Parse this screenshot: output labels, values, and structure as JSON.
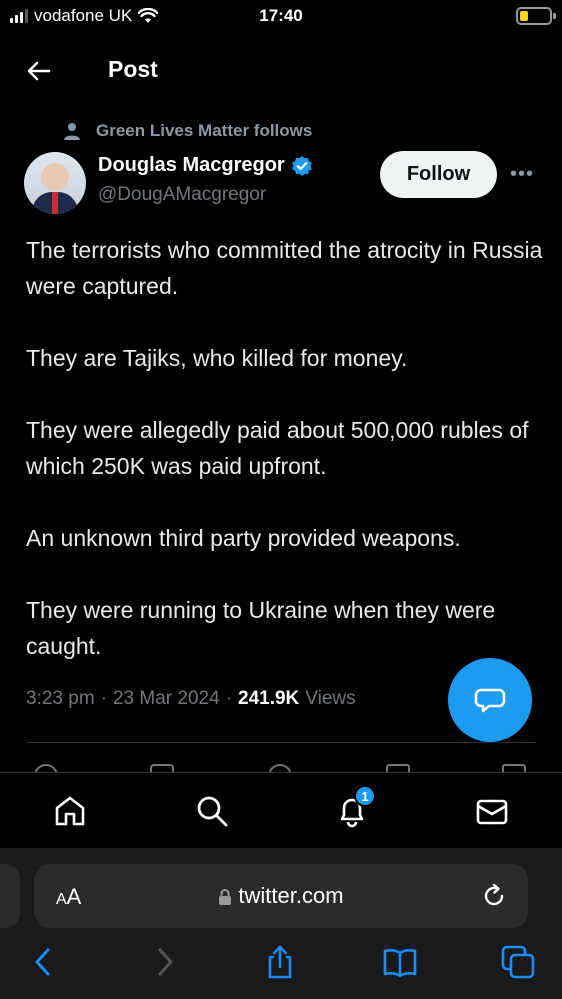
{
  "status_bar": {
    "carrier": "vodafone UK",
    "time": "17:40"
  },
  "header": {
    "title": "Post"
  },
  "tweet": {
    "social_context": "Green Lives Matter follows",
    "display_name": "Douglas Macgregor",
    "handle": "@DougAMacgregor",
    "follow_label": "Follow",
    "more_label": "•••",
    "paragraphs": [
      "The terrorists who committed the atrocity in Russia were captured.",
      "They are Tajiks, who killed for money.",
      "They were allegedly paid about 500,000 rubles of which 250K was paid upfront.",
      "An unknown third party provided weapons.",
      "They were running to Ukraine when they were caught."
    ],
    "time": "3:23 pm",
    "date": "23 Mar 2024",
    "views_count": "241.9K",
    "views_label": "Views"
  },
  "bottom_nav": {
    "notifications_badge": "1"
  },
  "browser": {
    "aa_label_small": "A",
    "aa_label_large": "A",
    "url": "twitter.com"
  },
  "colors": {
    "accent": "#1d9bf0",
    "background": "#000000",
    "text": "#e7e9ea",
    "muted": "#71767b"
  }
}
